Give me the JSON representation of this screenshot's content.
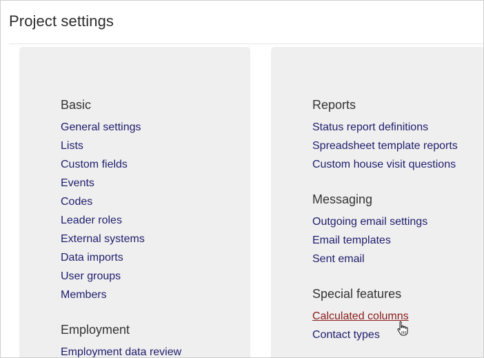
{
  "page": {
    "title": "Project settings"
  },
  "left_panel": {
    "sections": [
      {
        "heading": "Basic",
        "links": [
          "General settings",
          "Lists",
          "Custom fields",
          "Events",
          "Codes",
          "Leader roles",
          "External systems",
          "Data imports",
          "User groups",
          "Members"
        ]
      },
      {
        "heading": "Employment",
        "links": [
          "Employment data review"
        ]
      }
    ]
  },
  "right_panel": {
    "sections": [
      {
        "heading": "Reports",
        "links": [
          "Status report definitions",
          "Spreadsheet template reports",
          "Custom house visit questions"
        ]
      },
      {
        "heading": "Messaging",
        "links": [
          "Outgoing email settings",
          "Email templates",
          "Sent email"
        ]
      },
      {
        "heading": "Special features",
        "links": [
          "Calculated columns",
          "Contact types"
        ]
      }
    ]
  },
  "cursor": {
    "icon": "hand-pointer-icon",
    "hovered_link": "Calculated columns"
  },
  "colors": {
    "link": "#1d1d6e",
    "link_hover": "#8b1a1a",
    "panel_bg": "#efefef",
    "heading": "#333333"
  }
}
